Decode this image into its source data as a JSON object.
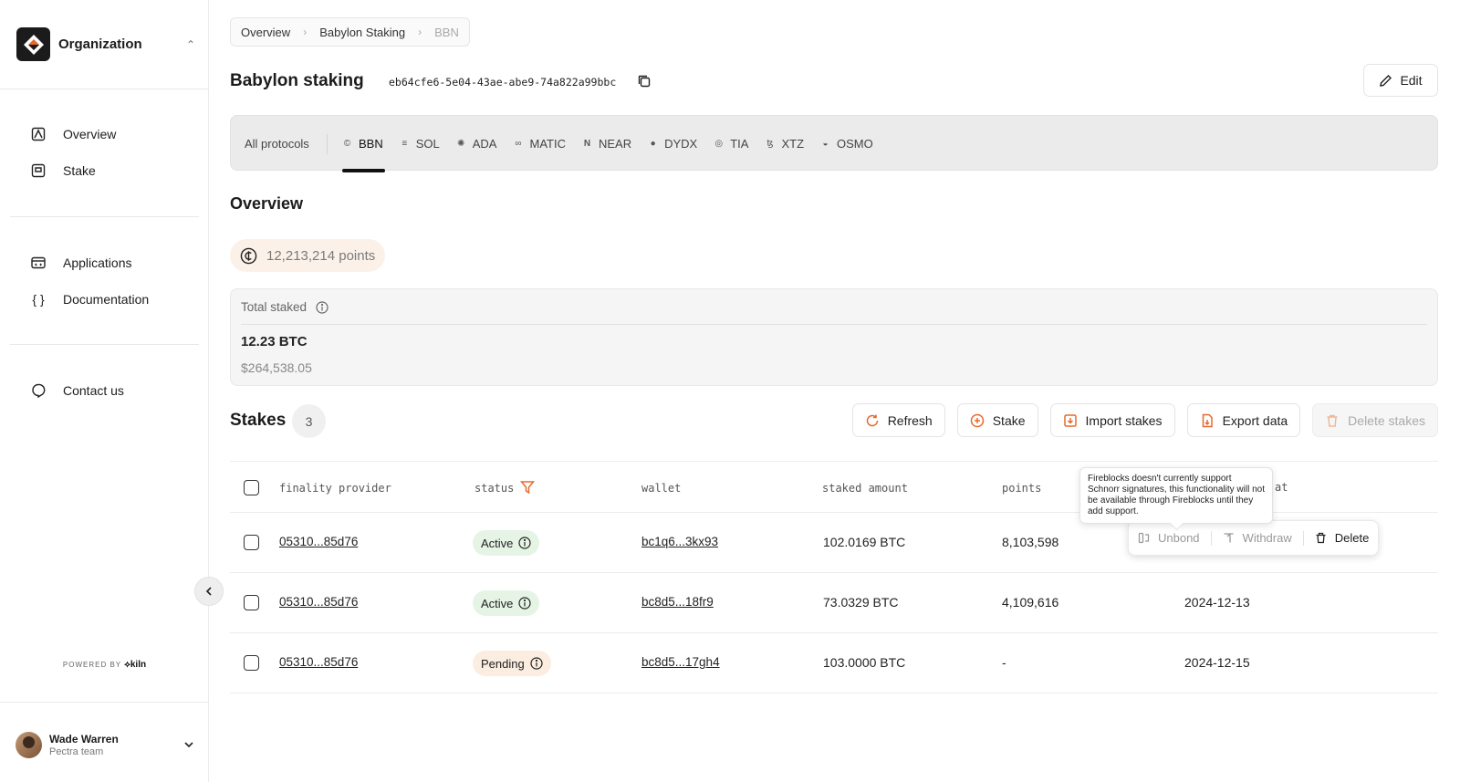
{
  "sidebar": {
    "org_name": "Organization",
    "nav_primary": [
      {
        "label": "Overview",
        "icon": "overview-icon"
      },
      {
        "label": "Stake",
        "icon": "stake-icon"
      }
    ],
    "nav_secondary": [
      {
        "label": "Applications",
        "icon": "applications-icon"
      },
      {
        "label": "Documentation",
        "icon": "documentation-icon"
      }
    ],
    "nav_tertiary": [
      {
        "label": "Contact us",
        "icon": "contact-icon"
      }
    ],
    "powered_by": "POWERED BY",
    "powered_brand": "kiln",
    "user": {
      "name": "Wade Warren",
      "team": "Pectra team"
    }
  },
  "breadcrumb": [
    "Overview",
    "Babylon Staking",
    "BBN"
  ],
  "header": {
    "title": "Babylon staking",
    "id": "eb64cfe6-5e04-43ae-abe9-74a822a99bbc",
    "edit_label": "Edit"
  },
  "protocols": {
    "all_label": "All protocols",
    "tabs": [
      {
        "label": "BBN",
        "active": true
      },
      {
        "label": "SOL"
      },
      {
        "label": "ADA"
      },
      {
        "label": "MATIC"
      },
      {
        "label": "NEAR"
      },
      {
        "label": "DYDX"
      },
      {
        "label": "TIA"
      },
      {
        "label": "XTZ"
      },
      {
        "label": "OSMO"
      }
    ]
  },
  "overview": {
    "heading": "Overview",
    "points": "12,213,214 points",
    "total_staked_label": "Total staked",
    "total_staked_value": "12.23 BTC",
    "total_staked_usd": "$264,538.05"
  },
  "stakes": {
    "heading": "Stakes",
    "count": "3",
    "actions": {
      "refresh": "Refresh",
      "stake": "Stake",
      "import": "Import stakes",
      "export": "Export data",
      "delete": "Delete stakes"
    },
    "columns": {
      "provider": "finality provider",
      "status": "status",
      "wallet": "wallet",
      "amount": "staked amount",
      "points": "points",
      "at": "at"
    },
    "rows": [
      {
        "provider": "05310...85d76",
        "status": "Active",
        "wallet": "bc1q6...3kx93",
        "amount": "102.0169 BTC",
        "points": "8,103,598",
        "date": ""
      },
      {
        "provider": "05310...85d76",
        "status": "Active",
        "wallet": "bc8d5...18fr9",
        "amount": "73.0329 BTC",
        "points": "4,109,616",
        "date": "2024-12-13"
      },
      {
        "provider": "05310...85d76",
        "status": "Pending",
        "wallet": "bc8d5...17gh4",
        "amount": "103.0000 BTC",
        "points": "-",
        "date": "2024-12-15"
      }
    ],
    "row_actions": {
      "unbond": "Unbond",
      "withdraw": "Withdraw",
      "delete": "Delete"
    },
    "tooltip": "Fireblocks doesn't currently support Schnorr signatures, this functionality will not be available through Fireblocks until they add support."
  },
  "colors": {
    "accent": "#e8692d",
    "active_bg": "#e6f4e5",
    "pending_bg": "#fbeee0"
  }
}
